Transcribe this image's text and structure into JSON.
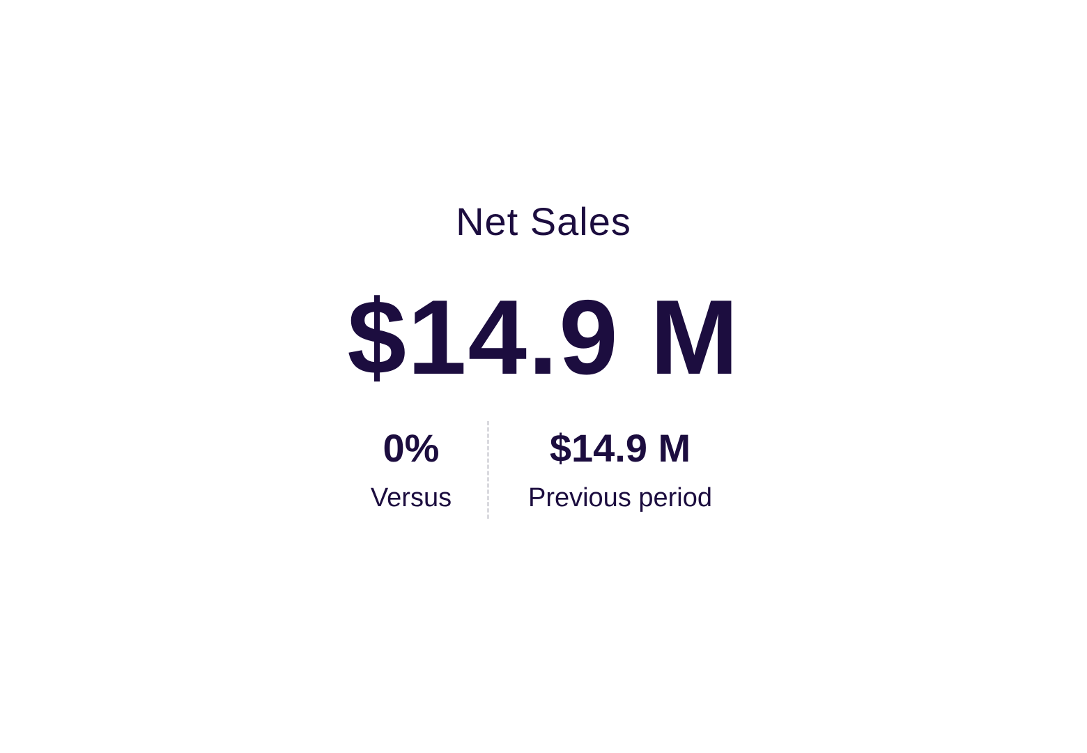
{
  "kpi": {
    "title": "Net Sales",
    "value": "$14.9 M",
    "comparison": {
      "change": "0%",
      "change_label": "Versus",
      "previous_value": "$14.9 M",
      "previous_label": "Previous period"
    }
  },
  "colors": {
    "text": "#1c0d3f",
    "background": "#ffffff",
    "divider": "#d9d9de"
  }
}
